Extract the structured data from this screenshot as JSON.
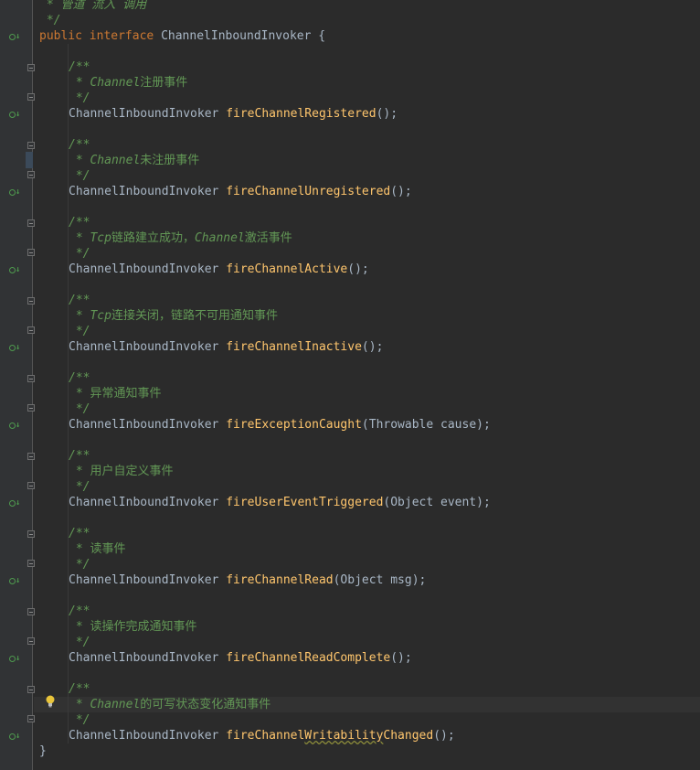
{
  "header_comment": [
    " * 管道 流入 调用",
    " */"
  ],
  "decl": {
    "public": "public",
    "interface": "interface",
    "name": "ChannelInboundInvoker",
    "brace": " {"
  },
  "close_brace": "}",
  "return_type": "ChannelInboundInvoker",
  "doc_open": "/**",
  "doc_close": " */",
  "doc_star": " * ",
  "methods": [
    {
      "comment_italic": "Channel",
      "comment_plain": "注册事件",
      "comment_tail": "",
      "name": "fireChannelRegistered",
      "params": "();"
    },
    {
      "comment_italic": "Channel",
      "comment_plain": "未注册事件",
      "comment_tail": "",
      "name": "fireChannelUnregistered",
      "params": "();"
    },
    {
      "comment_italic": "Tcp",
      "comment_plain": "链路建立成功，",
      "comment_tail_italic": "Channel",
      "comment_tail": "激活事件",
      "name": "fireChannelActive",
      "params": "();"
    },
    {
      "comment_italic": "Tcp",
      "comment_plain": "连接关闭，链路不可用通知事件",
      "comment_tail": "",
      "name": "fireChannelInactive",
      "params": "();"
    },
    {
      "comment_italic": "",
      "comment_plain": "异常通知事件",
      "comment_tail": "",
      "name": "fireExceptionCaught",
      "params": "(Throwable cause);"
    },
    {
      "comment_italic": "",
      "comment_plain": "用户自定义事件",
      "comment_tail": "",
      "name": "fireUserEventTriggered",
      "params": "(Object event);"
    },
    {
      "comment_italic": "",
      "comment_plain": "读事件",
      "comment_tail": "",
      "name": "fireChannelRead",
      "params": "(Object msg);"
    },
    {
      "comment_italic": "",
      "comment_plain": "读操作完成通知事件",
      "comment_tail": "",
      "name": "fireChannelReadComplete",
      "params": "();"
    },
    {
      "comment_italic": "Channel",
      "comment_plain": "的可写状态变化通知事件",
      "comment_tail": "",
      "name_pre": "fireChannel",
      "name_squig": "Writability",
      "name_post": "Changed",
      "params": "();"
    }
  ],
  "colors": {
    "background": "#2b2b2b",
    "gutter": "#313335",
    "keyword": "#cc7832",
    "method": "#ffc66d",
    "comment": "#629755",
    "identifier": "#a9b7c6",
    "implements_marker": "#4e9a4e"
  },
  "icons": [
    "implements-marker-icon",
    "fold-icon",
    "lightbulb-icon"
  ]
}
